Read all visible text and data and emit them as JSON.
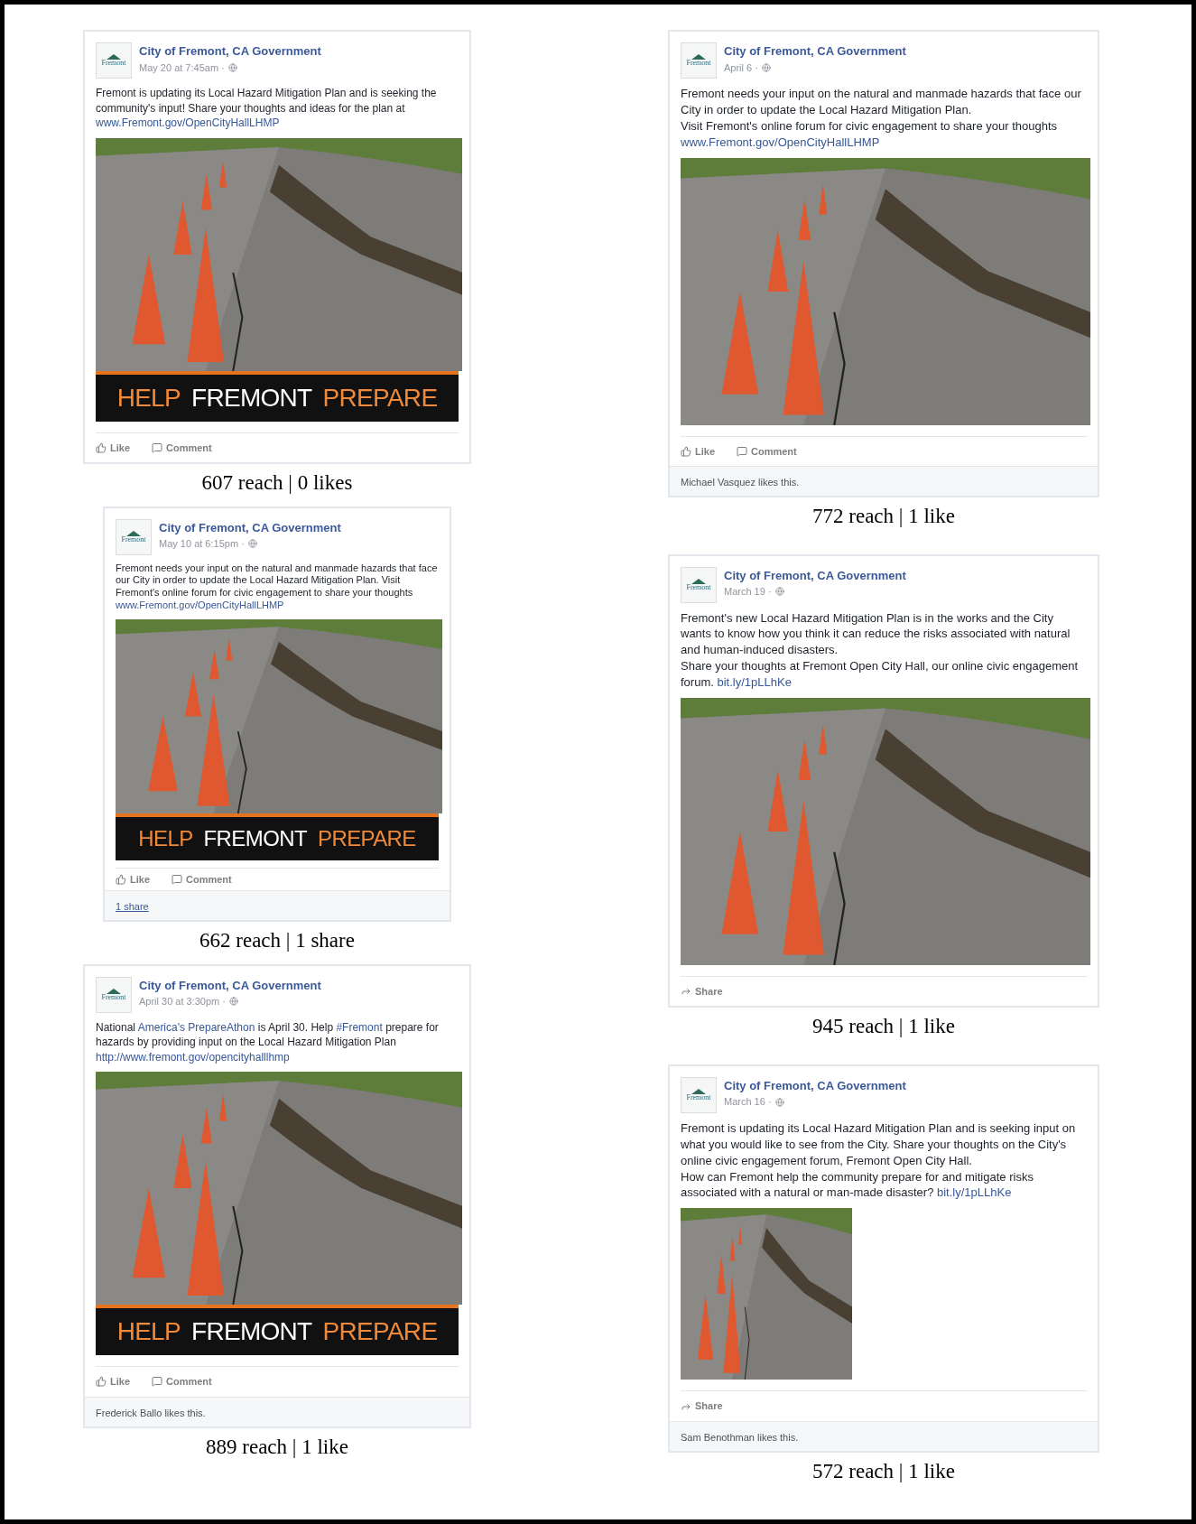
{
  "columns": [
    {
      "posts": [
        {
          "page_name": "City of Fremont, CA Government",
          "logo_text": "Fremont",
          "date": "May 20 at 7:45am ·",
          "paragraphs": [
            [
              {
                "kind": "text",
                "text": "Fremont is updating its Local Hazard Mitigation Plan and is seeking the community's input! Share your thoughts and ideas for the plan at "
              },
              {
                "kind": "link",
                "text": "www.Fremont.gov/OpenCityHallLHMP"
              }
            ]
          ],
          "image": {
            "kind": "banner",
            "banner": [
              {
                "kind": "accent",
                "text": "HELP"
              },
              {
                "kind": "plain",
                "text": "FREMONT"
              },
              {
                "kind": "accent",
                "text": "PREPARE"
              }
            ]
          },
          "actions": [
            {
              "kind": "like",
              "label": "Like"
            },
            {
              "kind": "comment",
              "label": "Comment"
            }
          ],
          "caption": "607 reach | 0 likes"
        },
        {
          "page_name": "City of Fremont, CA Government",
          "logo_text": "Fremont",
          "date": "May 10 at 6:15pm ·",
          "paragraphs": [
            [
              {
                "kind": "text",
                "text": "Fremont needs your input on the natural and manmade hazards that face our City in order to update the Local Hazard Mitigation Plan. Visit Fremont's online forum for civic engagement to share your thoughts "
              },
              {
                "kind": "link",
                "text": "www.Fremont.gov/OpenCityHallLHMP"
              }
            ]
          ],
          "image": {
            "kind": "banner",
            "banner": [
              {
                "kind": "accent",
                "text": "HELP"
              },
              {
                "kind": "plain",
                "text": "FREMONT"
              },
              {
                "kind": "accent",
                "text": "PREPARE"
              }
            ]
          },
          "actions": [
            {
              "kind": "like",
              "label": "Like"
            },
            {
              "kind": "comment",
              "label": "Comment"
            }
          ],
          "footer": {
            "kind": "link",
            "text": "1 share"
          },
          "caption": "662 reach | 1 share"
        },
        {
          "page_name": "City of Fremont, CA Government",
          "logo_text": "Fremont",
          "date": "April 30 at 3:30pm ·",
          "paragraphs": [
            [
              {
                "kind": "text",
                "text": "National "
              },
              {
                "kind": "link",
                "text": "America's PrepareAthon"
              },
              {
                "kind": "text",
                "text": " is April 30. Help "
              },
              {
                "kind": "link",
                "text": "#Fremont"
              },
              {
                "kind": "text",
                "text": " prepare for hazards by providing input on the Local Hazard Mitigation Plan "
              },
              {
                "kind": "link",
                "text": "http://www.fremont.gov/opencityhalllhmp"
              }
            ]
          ],
          "image": {
            "kind": "banner",
            "banner": [
              {
                "kind": "accent",
                "text": "HELP"
              },
              {
                "kind": "plain",
                "text": "FREMONT"
              },
              {
                "kind": "accent",
                "text": "PREPARE"
              }
            ]
          },
          "actions": [
            {
              "kind": "like",
              "label": "Like"
            },
            {
              "kind": "comment",
              "label": "Comment"
            }
          ],
          "footer": {
            "kind": "text",
            "text": "Frederick Ballo likes this."
          },
          "caption": "889 reach | 1 like"
        }
      ]
    },
    {
      "posts": [
        {
          "page_name": "City of Fremont, CA Government",
          "logo_text": "Fremont",
          "date": "April 6 ·",
          "paragraphs": [
            [
              {
                "kind": "text",
                "text": "Fremont needs your input on the natural and manmade hazards that face our City in order to update the Local Hazard Mitigation Plan."
              }
            ],
            [
              {
                "kind": "text",
                "text": "Visit Fremont's online forum for civic engagement to share your thoughts "
              },
              {
                "kind": "link",
                "text": "www.Fremont.gov/OpenCityHallLHMP"
              }
            ]
          ],
          "image": {
            "kind": "photo"
          },
          "actions": [
            {
              "kind": "like",
              "label": "Like"
            },
            {
              "kind": "comment",
              "label": "Comment"
            }
          ],
          "footer": {
            "kind": "text",
            "text": "Michael Vasquez likes this."
          },
          "caption": "772 reach | 1 like"
        },
        {
          "page_name": "City of Fremont, CA Government",
          "logo_text": "Fremont",
          "date": "March 19 ·",
          "paragraphs": [
            [
              {
                "kind": "text",
                "text": "Fremont's new Local Hazard Mitigation Plan is in the works and the City wants to know how you think it can reduce the risks associated with natural and human-induced disasters."
              }
            ],
            [
              {
                "kind": "text",
                "text": "Share your thoughts at Fremont Open City Hall, our online civic engagement forum. "
              },
              {
                "kind": "link",
                "text": "bit.ly/1pLLhKe"
              }
            ]
          ],
          "image": {
            "kind": "photo"
          },
          "actions": [
            {
              "kind": "share",
              "label": "Share"
            }
          ],
          "caption": "945 reach | 1 like"
        },
        {
          "page_name": "City of Fremont, CA Government",
          "logo_text": "Fremont",
          "date": "March 16 ·",
          "paragraphs": [
            [
              {
                "kind": "text",
                "text": "Fremont is updating its Local Hazard Mitigation Plan and is seeking input on what you would like to see from the City. Share your thoughts on the City's online civic engagement forum, Fremont Open City Hall."
              }
            ],
            [
              {
                "kind": "text",
                "text": "How can Fremont help the community prepare for and mitigate risks associated with a natural or man-made disaster? "
              },
              {
                "kind": "link",
                "text": "bit.ly/1pLLhKe"
              }
            ]
          ],
          "image": {
            "kind": "thumbnail"
          },
          "actions": [
            {
              "kind": "share",
              "label": "Share"
            }
          ],
          "footer": {
            "kind": "text",
            "text": "Sam Benothman likes this."
          },
          "caption": "572 reach | 1 like"
        }
      ]
    }
  ]
}
